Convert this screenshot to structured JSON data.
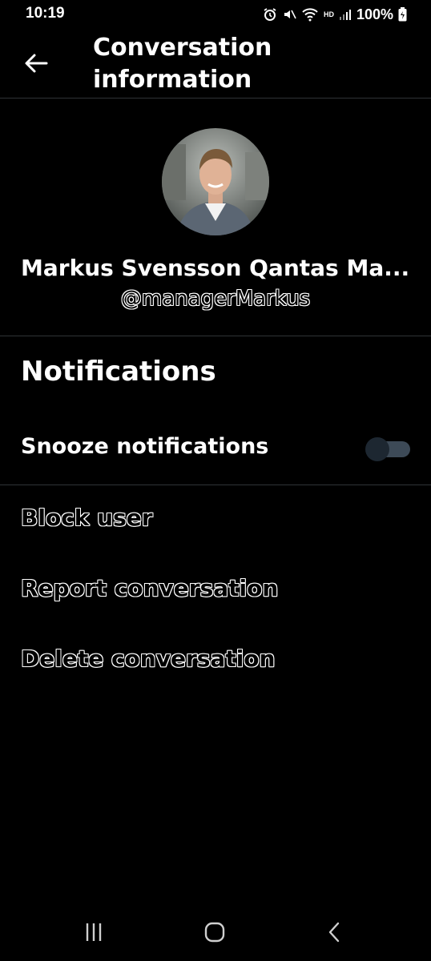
{
  "status_bar": {
    "time": "10:19",
    "battery": "100%",
    "network": "HD",
    "icons": [
      "alarm-icon",
      "mute-icon",
      "wifi-icon",
      "signal-icon",
      "battery-icon"
    ]
  },
  "header": {
    "title": "Conversation\ninformation",
    "back_icon": "arrow-left-icon"
  },
  "profile": {
    "name": "Markus Svensson Qantas Ma...",
    "handle": "@managerMarkus",
    "avatar": "profile-photo"
  },
  "notifications": {
    "section_title": "Notifications",
    "snooze_label": "Snooze notifications",
    "snooze_enabled": false
  },
  "actions": {
    "block": "Block user",
    "report": "Report conversation",
    "delete": "Delete conversation"
  },
  "nav_bar": {
    "icons": [
      "recent-apps-icon",
      "home-icon",
      "back-icon"
    ]
  },
  "colors": {
    "background": "#000000",
    "divider": "#2f3336",
    "toggle_track": "#3d4a57",
    "toggle_thumb": "#1d2731"
  }
}
